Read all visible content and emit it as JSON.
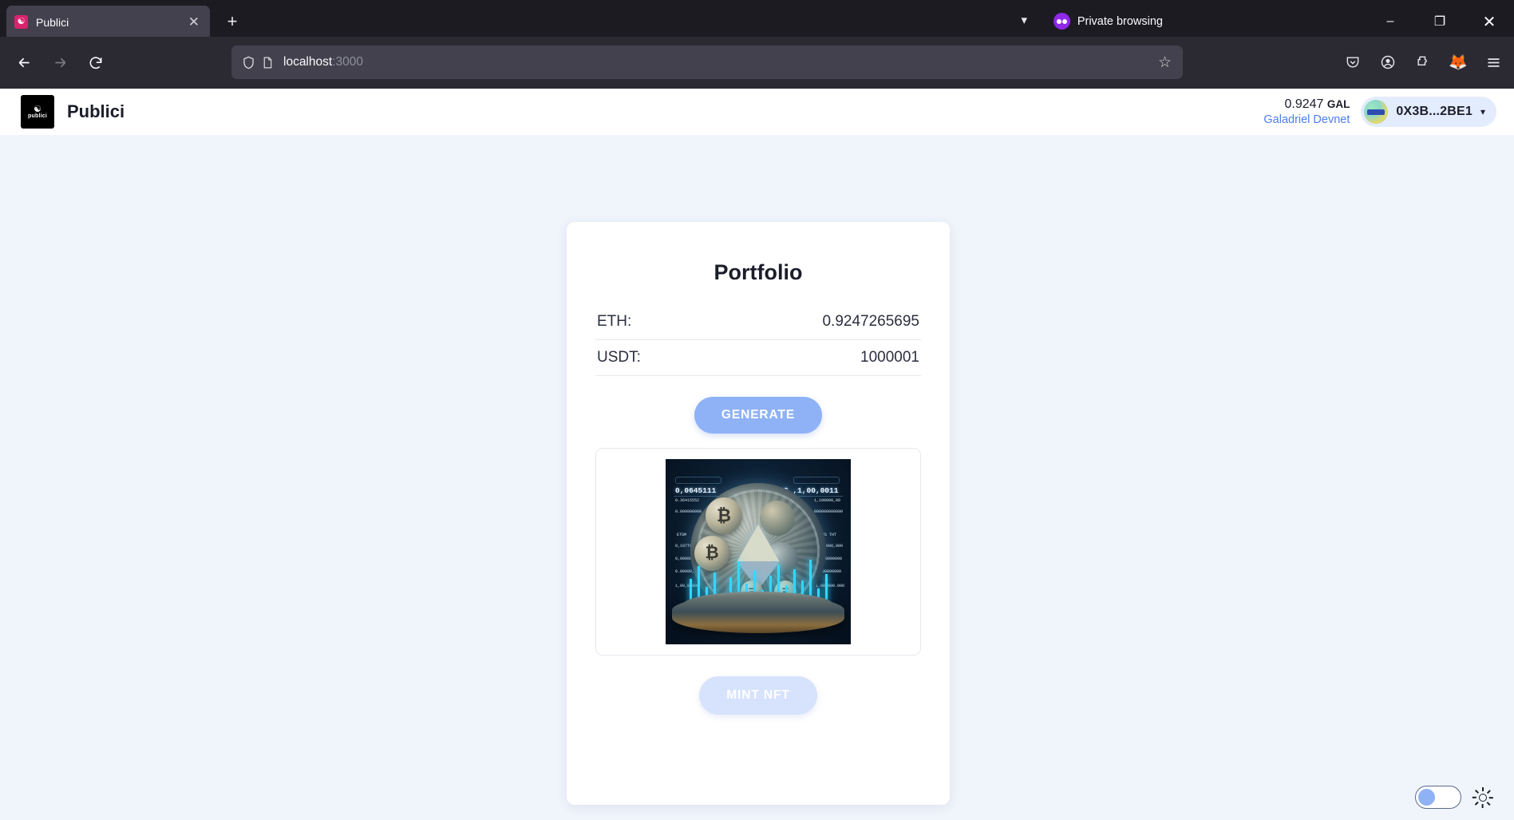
{
  "browser": {
    "tab": {
      "title": "Publici",
      "favicon": "publici-favicon",
      "close_icon": "close-icon"
    },
    "new_tab_icon": "plus-icon",
    "tab_list_icon": "chevron-down-icon",
    "private_browsing_label": "Private browsing",
    "private_browsing_icon": "mask-icon",
    "window_controls": {
      "minimize": "–",
      "restore": "❐",
      "close": "✕"
    },
    "nav": {
      "back_icon": "arrow-left-icon",
      "forward_icon": "arrow-right-icon",
      "reload_icon": "reload-icon"
    },
    "url": {
      "host": "localhost",
      "port": ":3000",
      "shield_icon": "shield-icon",
      "page_icon": "page-icon",
      "bookmark_icon": "star-icon"
    },
    "extensions": [
      "pocket-icon",
      "account-icon",
      "extensions-icon",
      "metamask-fox-icon",
      "app-menu-icon"
    ]
  },
  "app": {
    "brand": {
      "logo_mark": "☯",
      "logo_word": "publici",
      "name": "Publici"
    },
    "wallet": {
      "balance_amount": "0.9247",
      "balance_symbol": "GAL",
      "network": "Galadriel Devnet",
      "address": "0X3B...2BE1",
      "chevron_icon": "chevron-down-icon",
      "avatar_icon": "wallet-avatar"
    }
  },
  "portfolio": {
    "title": "Portfolio",
    "rows": [
      {
        "label": "ETH:",
        "value": "0.9247265695"
      },
      {
        "label": "USDT:",
        "value": "1000001"
      }
    ],
    "generate_label": "GENERATE",
    "mint_label": "MINT NFT",
    "nft_alt": "ai-generated-crypto-coin-artwork",
    "nft_hud": {
      "left_big": "0,0645111",
      "left_values": [
        "0.36415552",
        "0.000000000",
        "0,197TOT",
        "0,00000000",
        "0.00000,000",
        "1,00,00000"
      ],
      "left_ticker": "ETGM",
      "right_big": "$ ,1,00,0011",
      "right_values": [
        "1,100000,00",
        "000000000000",
        "00.000,000",
        "1,000000000",
        "1,00000000",
        "1,00,000.000"
      ],
      "right_ticker": "US THT"
    }
  },
  "theme": {
    "toggle_state": "off",
    "toggle_name": "dark-mode-toggle",
    "icon": "sun-icon"
  },
  "colors": {
    "accent": "#8fb2f6",
    "page_bg": "#f0f4fb",
    "chrome_bg": "#1c1b22",
    "navbar_bg": "#2b2a33",
    "link": "#4c7df0",
    "pill_bg": "#e3ecfd",
    "text": "#1b1d2a"
  }
}
